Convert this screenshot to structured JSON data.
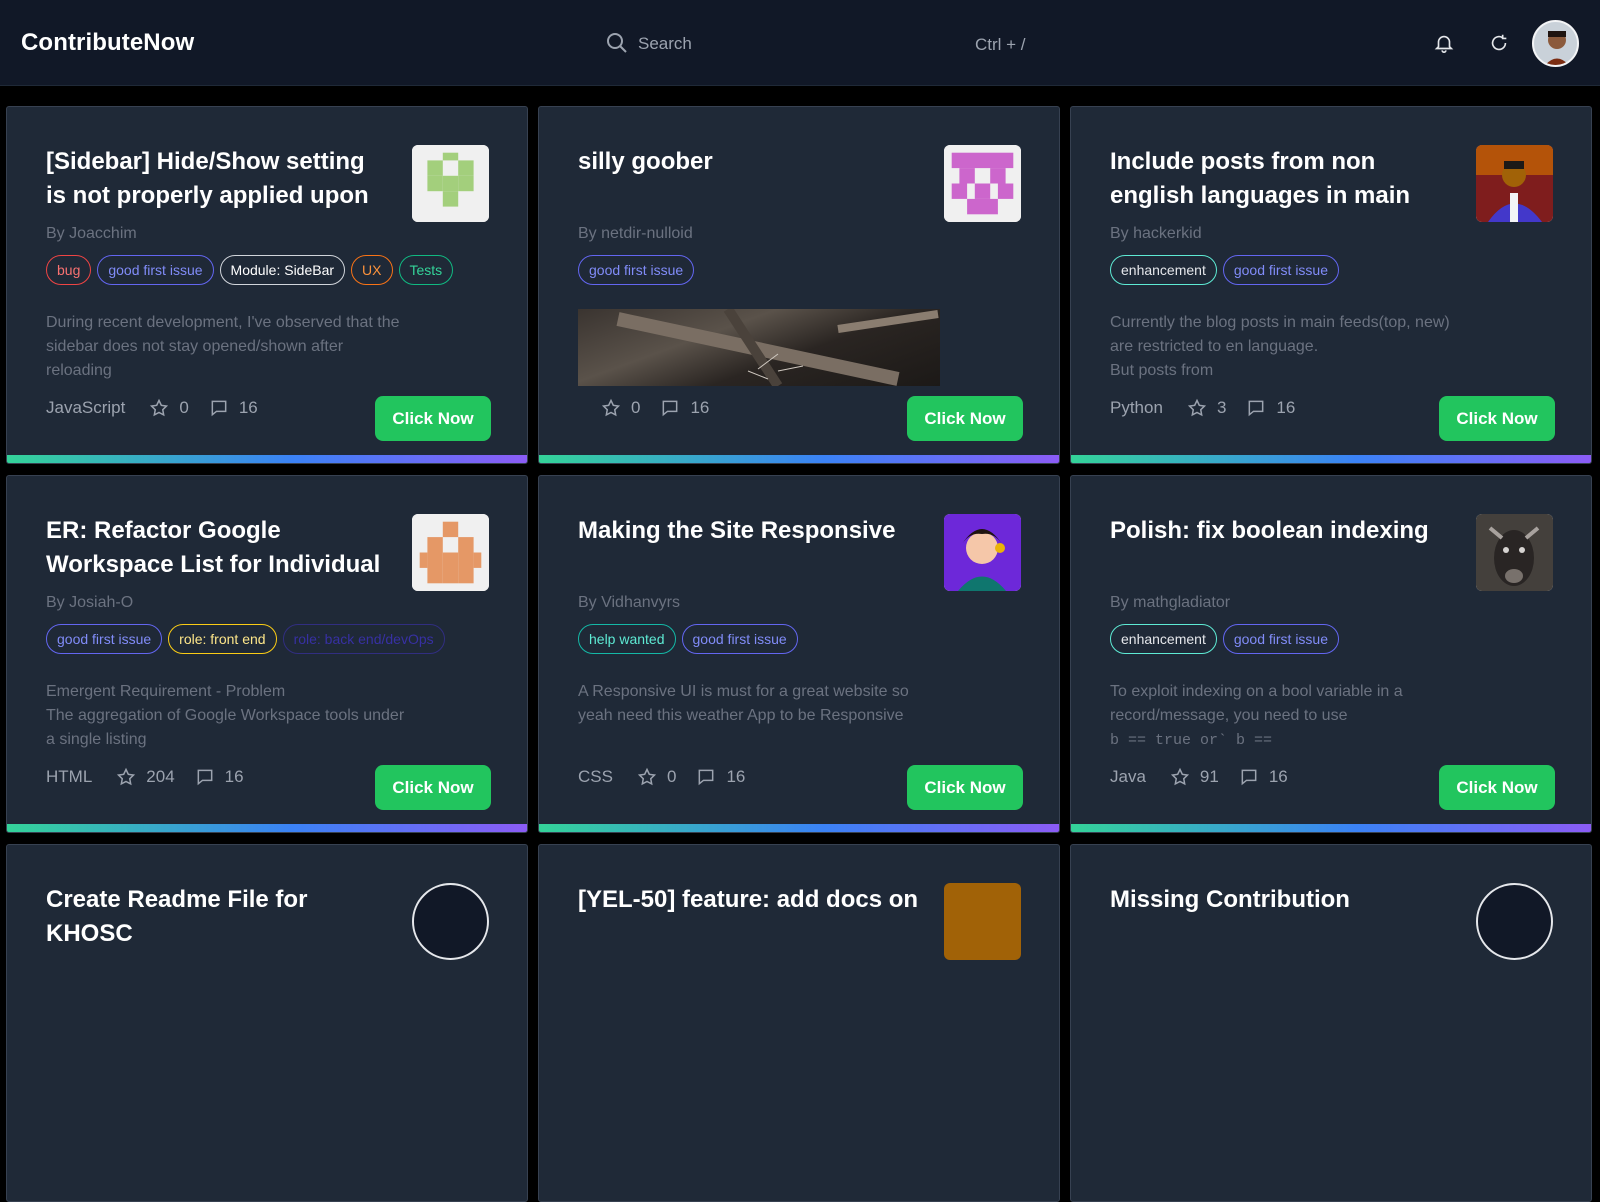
{
  "app": {
    "brand": "ContributeNow"
  },
  "search": {
    "placeholder": "Search",
    "shortcut": "Ctrl + /"
  },
  "header_icons": [
    "bell-icon",
    "refresh-icon",
    "avatar"
  ],
  "colors": {
    "accent_button": "#22c55e",
    "card_bg": "#1f2937",
    "topbar_bg": "#111827"
  },
  "button_label": "Click Now",
  "cards": [
    {
      "title": "[Sidebar] Hide/Show setting is not properly applied upon",
      "author": "By Joacchim",
      "tags": [
        {
          "label": "bug",
          "style": "red"
        },
        {
          "label": "good first issue",
          "style": "purple"
        },
        {
          "label": "Module: SideBar",
          "style": "white"
        },
        {
          "label": "UX",
          "style": "orange"
        },
        {
          "label": "Tests",
          "style": "green"
        }
      ],
      "description": "During recent development, I've observed that the sidebar does not stay opened/shown after reloading",
      "language": "JavaScript",
      "stars": "0",
      "comments": "16",
      "thumb": "identicon-green"
    },
    {
      "title": "silly goober",
      "author": "By netdir-nulloid",
      "tags": [
        {
          "label": "good first issue",
          "style": "purple"
        }
      ],
      "description": "",
      "language": "",
      "stars": "0",
      "comments": "16",
      "thumb": "identicon-magenta",
      "has_media": true
    },
    {
      "title": "Include posts from non english languages in main",
      "author": "By hackerkid",
      "tags": [
        {
          "label": "enhancement",
          "style": "tealw"
        },
        {
          "label": "good first issue",
          "style": "purple"
        }
      ],
      "description": "Currently the blog posts in main feeds(top, new) are restricted to en language.\nBut posts from",
      "language": "Python",
      "stars": "3",
      "comments": "16",
      "thumb": "photo-person"
    },
    {
      "title": "ER: Refactor Google Workspace List for Individual",
      "author": "By Josiah-O",
      "tags": [
        {
          "label": "good first issue",
          "style": "purple"
        },
        {
          "label": "role: front end",
          "style": "yellow"
        },
        {
          "label": "role: back end/devOps",
          "style": "dim"
        }
      ],
      "description": "Emergent Requirement - Problem\nThe aggregation of Google Workspace tools under a single listing",
      "language": "HTML",
      "stars": "204",
      "comments": "16",
      "thumb": "identicon-orange"
    },
    {
      "title": "Making the Site Responsive",
      "author": "By Vidhanvyrs",
      "tags": [
        {
          "label": "help wanted",
          "style": "teal"
        },
        {
          "label": "good first issue",
          "style": "purple"
        }
      ],
      "description": "A Responsive UI is must for a great website so yeah need this weather App to be Responsive",
      "language": "CSS",
      "stars": "0",
      "comments": "16",
      "thumb": "avatar-cartoon"
    },
    {
      "title": "Polish: fix boolean indexing",
      "author": "By mathgladiator",
      "tags": [
        {
          "label": "enhancement",
          "style": "tealw"
        },
        {
          "label": "good first issue",
          "style": "purple"
        }
      ],
      "description": "To exploit indexing on a bool variable in a record/message, you need to use",
      "description_code": "b == true or` b ==",
      "language": "Java",
      "stars": "91",
      "comments": "16",
      "thumb": "photo-goat"
    },
    {
      "title": "Create Readme File for KHOSC",
      "thumb": "avatar-dark"
    },
    {
      "title": "[YEL-50] feature: add docs on",
      "thumb": "photo-dog"
    },
    {
      "title": "Missing Contribution",
      "thumb": "avatar-dark"
    }
  ]
}
